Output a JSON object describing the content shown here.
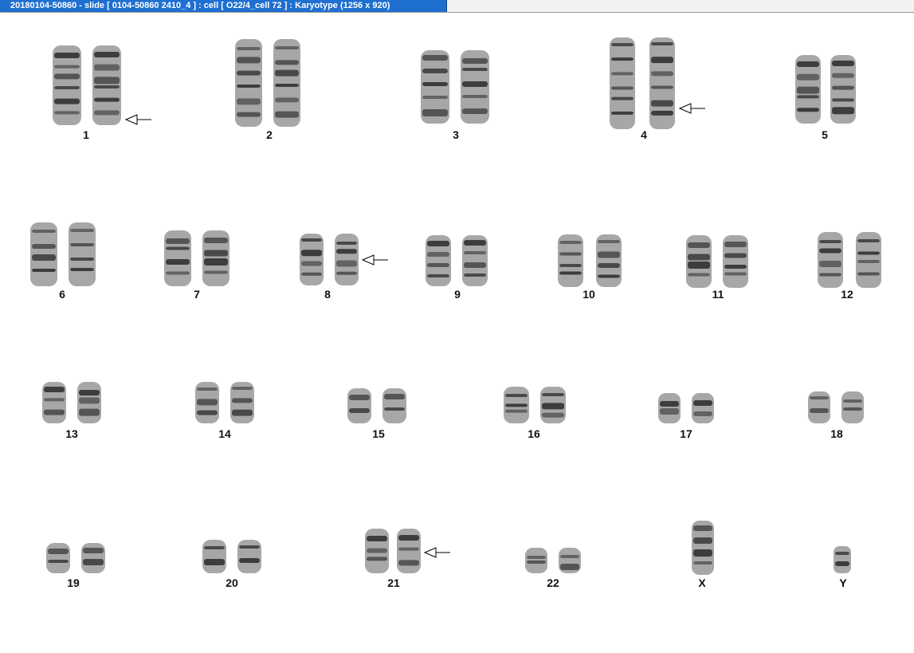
{
  "window": {
    "title": "20180104-50860 - slide [ 0104-50860 2410_4 ] : cell [ O22/4_cell 72 ] : Karyotype  (1256 x 920)"
  },
  "karyotype": {
    "chromosomes": [
      {
        "label": "1",
        "flagged": true
      },
      {
        "label": "2",
        "flagged": false
      },
      {
        "label": "3",
        "flagged": false
      },
      {
        "label": "4",
        "flagged": true
      },
      {
        "label": "5",
        "flagged": false
      },
      {
        "label": "6",
        "flagged": false
      },
      {
        "label": "7",
        "flagged": false
      },
      {
        "label": "8",
        "flagged": true
      },
      {
        "label": "9",
        "flagged": false
      },
      {
        "label": "10",
        "flagged": false
      },
      {
        "label": "11",
        "flagged": false
      },
      {
        "label": "12",
        "flagged": false
      },
      {
        "label": "13",
        "flagged": false
      },
      {
        "label": "14",
        "flagged": false
      },
      {
        "label": "15",
        "flagged": false
      },
      {
        "label": "16",
        "flagged": false
      },
      {
        "label": "17",
        "flagged": false
      },
      {
        "label": "18",
        "flagged": false
      },
      {
        "label": "19",
        "flagged": false
      },
      {
        "label": "20",
        "flagged": false
      },
      {
        "label": "21",
        "flagged": true
      },
      {
        "label": "22",
        "flagged": false
      },
      {
        "label": "X",
        "flagged": false
      },
      {
        "label": "Y",
        "flagged": false
      }
    ]
  },
  "colors": {
    "title_bar": "#1f6fd0",
    "title_text": "#ffffff",
    "chromosome": "#2a2a2a",
    "background": "#ffffff"
  },
  "icons": {
    "flag_marker": "left-arrow-icon"
  }
}
